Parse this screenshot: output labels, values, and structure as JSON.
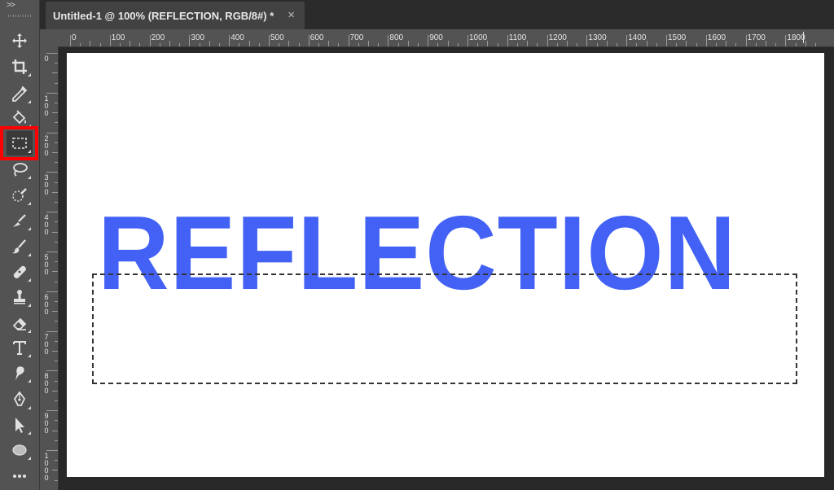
{
  "toolbar": {
    "collapse_label": ">>",
    "tools": [
      {
        "name": "move-icon"
      },
      {
        "name": "crop-icon"
      },
      {
        "name": "eyedropper-icon"
      },
      {
        "name": "paint-bucket-icon"
      },
      {
        "name": "rectangular-marquee-icon",
        "active": true
      },
      {
        "name": "lasso-icon"
      },
      {
        "name": "quick-selection-icon"
      },
      {
        "name": "pen-brush-icon"
      },
      {
        "name": "brush-icon"
      },
      {
        "name": "healing-brush-icon"
      },
      {
        "name": "clone-stamp-icon"
      },
      {
        "name": "eraser-icon"
      },
      {
        "name": "type-icon"
      },
      {
        "name": "smudge-icon"
      },
      {
        "name": "pen-icon"
      },
      {
        "name": "path-selection-icon"
      },
      {
        "name": "ellipse-icon"
      },
      {
        "name": "more-tools-icon"
      }
    ]
  },
  "document": {
    "tab_title": "Untitled-1 @ 100% (REFLECTION, RGB/8#) *",
    "close_label": "×",
    "canvas_text": "REFLECTION"
  },
  "ruler_top": {
    "labels": [
      "0",
      "100",
      "200",
      "300",
      "400",
      "500",
      "600",
      "700",
      "800",
      "900",
      "1000",
      "1100",
      "1200",
      "1300",
      "1400",
      "1500",
      "1600",
      "1700",
      "1800"
    ]
  },
  "ruler_left": {
    "labels": [
      "0",
      "100",
      "200",
      "300",
      "400",
      "500",
      "600",
      "700",
      "800",
      "900",
      "1000"
    ]
  },
  "colors": {
    "text_blue": "#4362f5",
    "highlight_red": "#ff0000"
  }
}
